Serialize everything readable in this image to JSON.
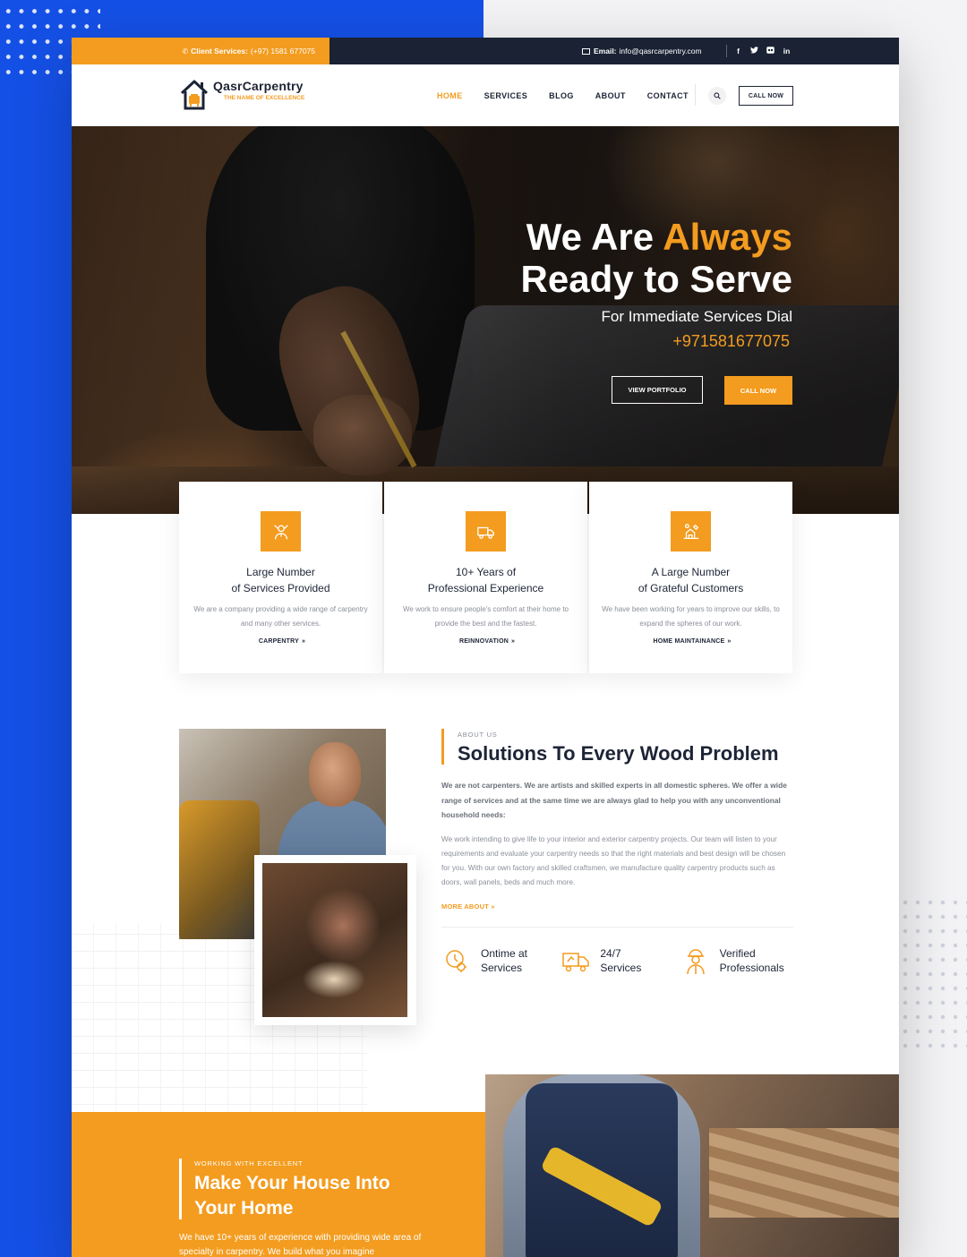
{
  "topbar": {
    "client_label": "Client Services:",
    "client_phone": "(+97) 1581 677075",
    "email_label": "Email:",
    "email_value": "info@qasrcarpentry.com",
    "social": [
      "f",
      "t",
      "fl",
      "in"
    ]
  },
  "header": {
    "logo_name": "QasrCarpentry",
    "logo_tagline": "THE NAME OF EXCELLENCE",
    "nav": [
      "HOME",
      "SERVICES",
      "BLOG",
      "ABOUT",
      "CONTACT"
    ],
    "active_nav": "HOME",
    "call_button": "CALL NOW"
  },
  "hero": {
    "title_part1": "We Are ",
    "title_accent": "Always",
    "title_line2": "Ready to Serve",
    "subtitle": "For Immediate Services Dial",
    "phone": "+971581677075",
    "btn_portfolio": "VIEW PORTFOLIO",
    "btn_call": "CALL NOW"
  },
  "features": [
    {
      "icon": "carpenter-icon",
      "title_line1": "Large Number",
      "title_line2": "of Services Provided",
      "desc": "We are a company providing a wide range of carpentry and many other services.",
      "link": "CARPENTRY"
    },
    {
      "icon": "truck-icon",
      "title_line1": "10+ Years of",
      "title_line2": "Professional Experience",
      "desc": "We work to ensure people's comfort at their home to provide the best and the fastest.",
      "link": "REINNOVATION"
    },
    {
      "icon": "house-tools-icon",
      "title_line1": "A Large Number",
      "title_line2": "of Grateful Customers",
      "desc": "We have been working for years to improve our skills, to expand the spheres of our work.",
      "link": "HOME MAINTAINANCE"
    }
  ],
  "about": {
    "label": "ABOUT US",
    "title": "Solutions To Every Wood Problem",
    "lead": "We are not carpenters. We are artists and skilled experts in all domestic spheres. We offer a wide range of services and at the same time we are always glad to help you with any unconventional household needs:",
    "body": "We work intending to give life to your interior and exterior carpentry projects. Our team will listen to your requirements and evaluate your carpentry needs so that the right materials and best design will be chosen for you. With our own factory and skilled craftsmen, we manufacture quality carpentry products such as doors, wall panels, beds and much more.",
    "more_link": "MORE ABOUT",
    "stats": [
      {
        "icon": "clock-gear-icon",
        "line1": "Ontime at",
        "line2": "Services"
      },
      {
        "icon": "delivery-truck-icon",
        "line1": "24/7",
        "line2": "Services"
      },
      {
        "icon": "worker-icon",
        "line1": "Verified",
        "line2": "Professionals"
      }
    ]
  },
  "promo": {
    "label": "WORKING WITH EXCELLENT",
    "title_line1": "Make Your House Into",
    "title_line2": "Your Home",
    "text": "We have 10+ years of experience with providing wide area of specialty in carpentry. We build what you imagine"
  },
  "colors": {
    "accent": "#f39c1f",
    "dark": "#1a2234",
    "brand_blue": "#1550e6"
  }
}
